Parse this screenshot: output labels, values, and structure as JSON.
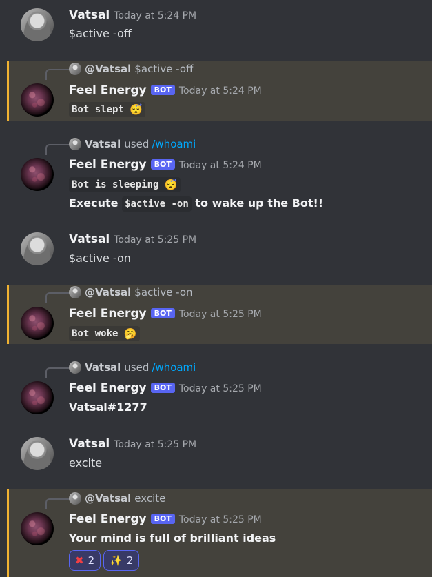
{
  "messages": [
    {
      "author": "Vatsal",
      "timestamp": "Today at 5:24 PM",
      "text": "$active -off"
    },
    {
      "reply_name": "@Vatsal",
      "reply_text": "$active -off",
      "author": "Feel Energy",
      "badge": "BOT",
      "timestamp": "Today at 5:24 PM",
      "code": "Bot slept",
      "emoji": "😴"
    },
    {
      "reply_name": "Vatsal",
      "reply_used": "used",
      "reply_cmd": "/whoami",
      "author": "Feel Energy",
      "badge": "BOT",
      "timestamp": "Today at 5:24 PM",
      "code": "Bot is sleeping ",
      "emoji": "😴",
      "line2_before": "Execute",
      "line2_code": "$active -on",
      "line2_after": "to wake up the Bot!!"
    },
    {
      "author": "Vatsal",
      "timestamp": "Today at 5:25 PM",
      "text": "$active -on"
    },
    {
      "reply_name": "@Vatsal",
      "reply_text": "$active -on",
      "author": "Feel Energy",
      "badge": "BOT",
      "timestamp": "Today at 5:25 PM",
      "code": "Bot woke",
      "emoji": "🥱"
    },
    {
      "reply_name": "Vatsal",
      "reply_used": "used",
      "reply_cmd": "/whoami",
      "author": "Feel Energy",
      "badge": "BOT",
      "timestamp": "Today at 5:25 PM",
      "text": "Vatsal#1277"
    },
    {
      "author": "Vatsal",
      "timestamp": "Today at 5:25 PM",
      "text": "excite"
    },
    {
      "reply_name": "@Vatsal",
      "reply_text": "excite",
      "author": "Feel Energy",
      "badge": "BOT",
      "timestamp": "Today at 5:25 PM",
      "text": "Your mind is full of brilliant ideas",
      "reactions": [
        {
          "icon": "cross-mark-icon",
          "count": "2"
        },
        {
          "icon": "sparkles-icon",
          "count": "2"
        }
      ]
    }
  ]
}
